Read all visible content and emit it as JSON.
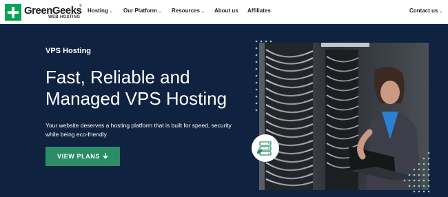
{
  "brand": {
    "name": "GreenGeeks",
    "tagline": "WEB HOSTING",
    "trademark": "®",
    "color": "#00a651"
  },
  "nav": {
    "items": [
      {
        "label": "Hosting",
        "has_dropdown": true
      },
      {
        "label": "Our Platform",
        "has_dropdown": true
      },
      {
        "label": "Resources",
        "has_dropdown": true
      },
      {
        "label": "About us",
        "has_dropdown": false
      },
      {
        "label": "Affiliates",
        "has_dropdown": false
      }
    ],
    "contact": {
      "label": "Contact us",
      "has_dropdown": true
    },
    "caret_glyph": "⌄"
  },
  "hero": {
    "kicker": "VPS Hosting",
    "title": "Fast, Reliable and Managed VPS Hosting",
    "description": "Your website deserves a hosting platform that is built for speed, security while being eco-friendly",
    "cta_label": "VIEW PLANS",
    "cta_icon": "arrow-down-icon",
    "cta_color": "#2a8d66",
    "background_color": "#0f2340"
  },
  "image": {
    "subject": "technician with laptop in server room",
    "badge_icon": "eco-server-icon",
    "dot_color": "#8fd3c7"
  }
}
